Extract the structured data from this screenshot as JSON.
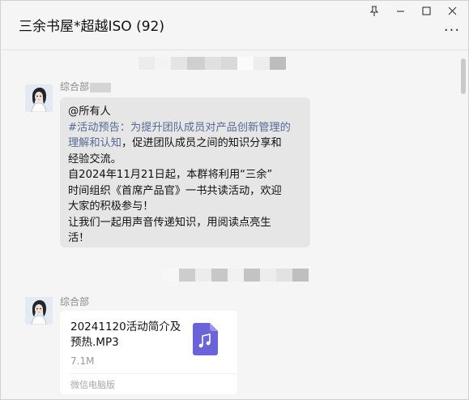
{
  "window": {
    "title": "三余书屋*超越ISO (92)",
    "controls": {
      "pin": "⊥",
      "minimize": "—",
      "maximize": "□",
      "close": "✕"
    },
    "more": "···"
  },
  "messages": [
    {
      "sender": "综合部",
      "paragraphs": [
        {
          "lines": [
            "@所有人"
          ]
        },
        {
          "hashtag_lines": [
            "#活动预告：为提升团队成员对产品创新管理的",
            "理解和认知"
          ],
          "lines_after": [
            "，促进团队成员之间的知识分享和",
            "经验交流。"
          ]
        },
        {
          "lines": [
            "自2024年11月21日起，本群将利用“三余”",
            "时间组织《首席产品官》一书共读活动，欢迎",
            "大家的积极参与！",
            "让我们一起用声音传递知识，用阅读点亮生",
            "活！"
          ]
        }
      ]
    },
    {
      "sender": "综合部",
      "file": {
        "name_lines": [
          "20241120活动简介及",
          "预热.MP3"
        ],
        "size": "7.1M",
        "source": "微信电脑版",
        "icon": "music-file-icon",
        "icon_color": "#6a63d9"
      }
    }
  ],
  "colors": {
    "hashtag": "#576b95",
    "bubble": "#e6e6e6",
    "background": "#f5f5f5"
  }
}
